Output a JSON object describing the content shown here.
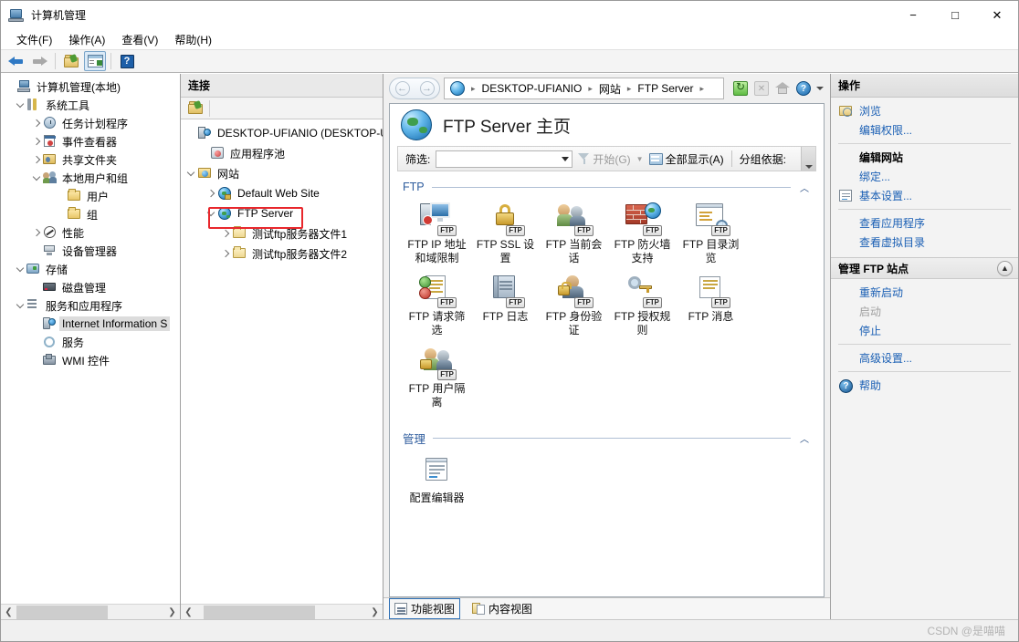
{
  "window": {
    "title": "计算机管理",
    "app_icon": "computer-management-icon",
    "minimize": "−",
    "maximize": "□",
    "close": "✕"
  },
  "menubar": [
    {
      "label": "文件(F)"
    },
    {
      "label": "操作(A)"
    },
    {
      "label": "查看(V)"
    },
    {
      "label": "帮助(H)"
    }
  ],
  "toolbar": [
    {
      "name": "back-arrow-icon",
      "title": "后退"
    },
    {
      "name": "forward-arrow-icon",
      "title": "前进"
    },
    {
      "name": "up-folder-icon",
      "title": "向上"
    },
    {
      "name": "show-console-tree-icon",
      "title": "显示/隐藏控制台树"
    },
    {
      "name": "help-icon",
      "title": "帮助",
      "glyph": "?"
    }
  ],
  "mmc_tree": [
    {
      "label": "计算机管理(本地)",
      "indent": 0,
      "expander": "none",
      "icon": "computer-icon"
    },
    {
      "label": "系统工具",
      "indent": 1,
      "expander": "open",
      "icon": "system-tools-icon"
    },
    {
      "label": "任务计划程序",
      "indent": 2,
      "expander": "collapsed",
      "icon": "task-scheduler-icon"
    },
    {
      "label": "事件查看器",
      "indent": 2,
      "expander": "collapsed",
      "icon": "event-viewer-icon"
    },
    {
      "label": "共享文件夹",
      "indent": 2,
      "expander": "collapsed",
      "icon": "shared-folders-icon"
    },
    {
      "label": "本地用户和组",
      "indent": 2,
      "expander": "open",
      "icon": "local-users-groups-icon"
    },
    {
      "label": "用户",
      "indent": 3,
      "expander": "none",
      "icon": "folder-icon"
    },
    {
      "label": "组",
      "indent": 3,
      "expander": "none",
      "icon": "folder-icon"
    },
    {
      "label": "性能",
      "indent": 2,
      "expander": "collapsed",
      "icon": "performance-icon"
    },
    {
      "label": "设备管理器",
      "indent": 2,
      "expander": "none",
      "icon": "device-manager-icon"
    },
    {
      "label": "存储",
      "indent": 1,
      "expander": "open",
      "icon": "storage-icon"
    },
    {
      "label": "磁盘管理",
      "indent": 2,
      "expander": "none",
      "icon": "disk-management-icon"
    },
    {
      "label": "服务和应用程序",
      "indent": 1,
      "expander": "open",
      "icon": "services-apps-icon"
    },
    {
      "label": "Internet Information S",
      "indent": 2,
      "expander": "none",
      "icon": "iis-icon",
      "selected": true
    },
    {
      "label": "服务",
      "indent": 2,
      "expander": "none",
      "icon": "services-icon"
    },
    {
      "label": "WMI 控件",
      "indent": 2,
      "expander": "none",
      "icon": "wmi-icon"
    }
  ],
  "connections": {
    "header": "连接",
    "toolbar_icon": "connect-folder-icon",
    "tree": [
      {
        "label": "DESKTOP-UFIANIO (DESKTOP-U",
        "indent": 0,
        "expander": "none",
        "icon": "server-icon"
      },
      {
        "label": "应用程序池",
        "indent": 1,
        "expander": "none",
        "icon": "application-pools-icon"
      },
      {
        "label": "网站",
        "indent": 1,
        "expander": "open",
        "icon": "sites-folder-icon"
      },
      {
        "label": "Default Web Site",
        "indent": 2,
        "expander": "collapsed",
        "icon": "website-icon"
      },
      {
        "label": "FTP Server",
        "indent": 2,
        "expander": "open",
        "icon": "ftp-site-icon",
        "highlighted": true
      },
      {
        "label": "测试ftp服务器文件1",
        "indent": 3,
        "expander": "collapsed",
        "icon": "virtual-directory-icon"
      },
      {
        "label": "测试ftp服务器文件2",
        "indent": 3,
        "expander": "collapsed",
        "icon": "virtual-directory-icon"
      }
    ]
  },
  "breadcrumb": {
    "back_icon": "back-arrow-icon",
    "forward_icon": "forward-arrow-icon",
    "site_icon": "globe-icon",
    "items": [
      "DESKTOP-UFIANIO",
      "网站",
      "FTP Server"
    ],
    "separator": "▸",
    "tools": [
      {
        "name": "refresh-icon",
        "title": "刷新"
      },
      {
        "name": "stop-icon",
        "title": "停止",
        "disabled": true
      },
      {
        "name": "home-icon",
        "title": "主页"
      },
      {
        "name": "help-icon",
        "title": "帮助"
      },
      {
        "name": "chevron-down-icon",
        "title": "更多"
      }
    ]
  },
  "page": {
    "icon": "ftp-server-globe-icon",
    "title": "FTP Server 主页"
  },
  "filter_bar": {
    "label": "筛选:",
    "input_value": "",
    "input_placeholder": "",
    "go_label": "开始(G)",
    "show_all_label": "全部显示(A)",
    "group_by_label": "分组依据:",
    "funnel_icon": "funnel-icon",
    "show_all_icon": "show-all-icon",
    "scroll_icon": "chevron-down-icon"
  },
  "sections": [
    {
      "title": "FTP",
      "chevron": "︿",
      "items": [
        {
          "label": "FTP IP 地址和域限制",
          "icon": "ftp-ip-domain-restrictions-icon",
          "badge": "FTP"
        },
        {
          "label": "FTP SSL 设置",
          "icon": "ftp-ssl-settings-icon",
          "badge": "FTP"
        },
        {
          "label": "FTP 当前会话",
          "icon": "ftp-current-sessions-icon",
          "badge": "FTP"
        },
        {
          "label": "FTP 防火墙支持",
          "icon": "ftp-firewall-support-icon",
          "badge": "FTP"
        },
        {
          "label": "FTP 目录浏览",
          "icon": "ftp-directory-browsing-icon",
          "badge": "FTP"
        },
        {
          "label": "FTP 请求筛选",
          "icon": "ftp-request-filtering-icon",
          "badge": "FTP"
        },
        {
          "label": "FTP 日志",
          "icon": "ftp-logging-icon",
          "badge": "FTP"
        },
        {
          "label": "FTP 身份验证",
          "icon": "ftp-authentication-icon",
          "badge": "FTP"
        },
        {
          "label": "FTP 授权规则",
          "icon": "ftp-authorization-rules-icon",
          "badge": "FTP"
        },
        {
          "label": "FTP 消息",
          "icon": "ftp-messages-icon",
          "badge": "FTP"
        },
        {
          "label": "FTP 用户隔离",
          "icon": "ftp-user-isolation-icon",
          "badge": "FTP"
        }
      ]
    },
    {
      "title": "管理",
      "chevron": "︿",
      "items": [
        {
          "label": "配置编辑器",
          "icon": "configuration-editor-icon",
          "badge": ""
        }
      ]
    }
  ],
  "view_tabs": [
    {
      "label": "功能视图",
      "icon": "features-view-icon",
      "active": true
    },
    {
      "label": "内容视图",
      "icon": "content-view-icon",
      "active": false
    }
  ],
  "actions": {
    "header": "操作",
    "groups": [
      {
        "items": [
          {
            "label": "浏览",
            "icon": "browse-icon",
            "style": "link"
          },
          {
            "label": "编辑权限...",
            "icon": "",
            "style": "link"
          }
        ]
      },
      {
        "items": [
          {
            "label": "编辑网站",
            "icon": "",
            "style": "bold"
          },
          {
            "label": "绑定...",
            "icon": "",
            "style": "link"
          },
          {
            "label": "基本设置...",
            "icon": "basic-settings-icon",
            "style": "link"
          }
        ]
      },
      {
        "items": [
          {
            "label": "查看应用程序",
            "icon": "",
            "style": "link"
          },
          {
            "label": "查看虚拟目录",
            "icon": "",
            "style": "link"
          }
        ]
      }
    ],
    "subsection": {
      "title": "管理 FTP 站点",
      "collapse_icon": "chevron-up-icon",
      "items": [
        {
          "label": "重新启动",
          "icon": "",
          "style": "link"
        },
        {
          "label": "启动",
          "icon": "",
          "style": "dim"
        },
        {
          "label": "停止",
          "icon": "",
          "style": "link"
        }
      ],
      "trailing": [
        {
          "label": "高级设置...",
          "icon": "",
          "style": "link"
        },
        {
          "label": "帮助",
          "icon": "help-blue-icon",
          "style": "link"
        }
      ]
    }
  },
  "statusbar": {
    "watermark": "CSDN @是喵喵"
  }
}
